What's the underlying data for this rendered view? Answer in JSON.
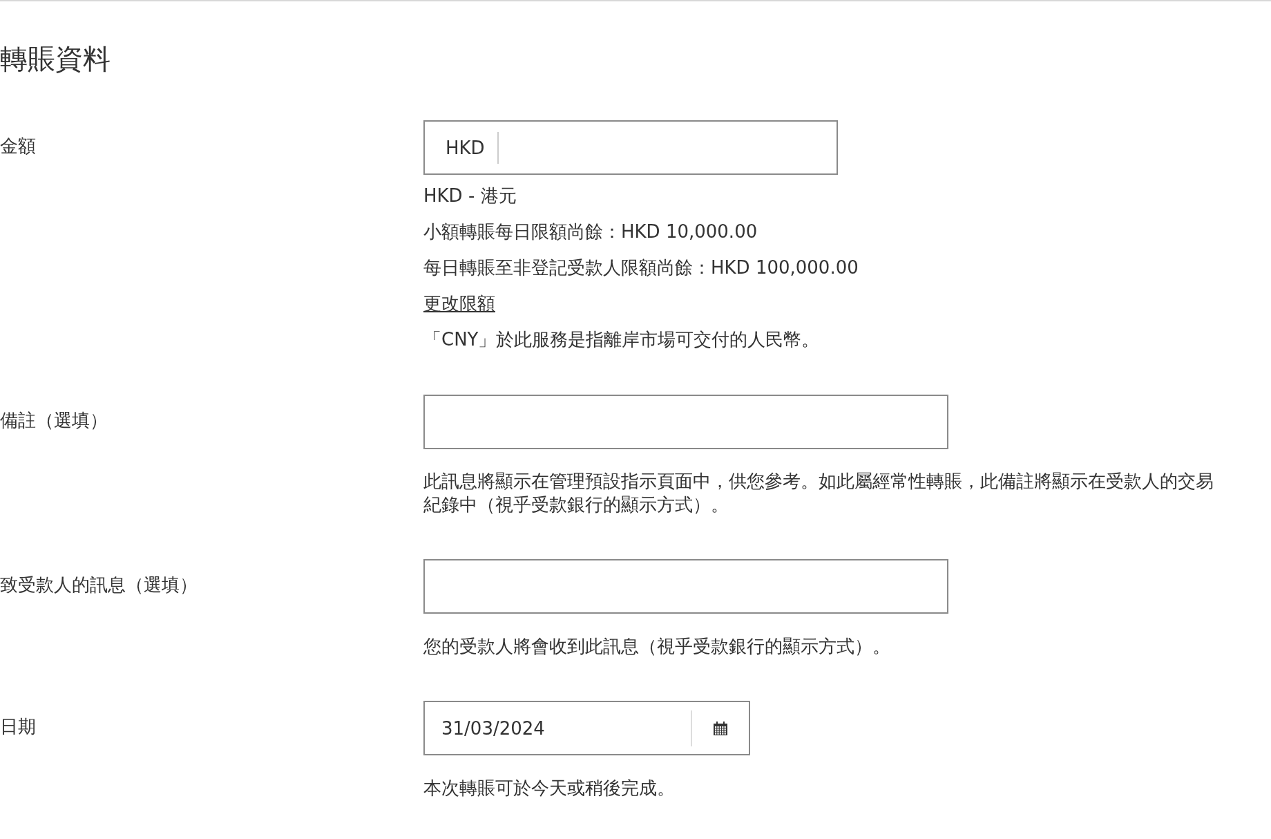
{
  "section_title": "轉賬資料",
  "amount": {
    "label": "金額",
    "currency_prefix": "HKD",
    "notes": [
      {
        "kind": "text",
        "text": "HKD - 港元"
      },
      {
        "kind": "text",
        "text": "小額轉賬每日限額尚餘：HKD 10,000.00"
      },
      {
        "kind": "text",
        "text": "每日轉賬至非登記受款人限額尚餘：HKD 100,000.00"
      },
      {
        "kind": "link",
        "text": "更改限額"
      },
      {
        "kind": "text",
        "text": "「CNY」於此服務是指離岸市場可交付的人民幣。"
      }
    ]
  },
  "memo": {
    "label": "備註（選填）",
    "help": "此訊息將顯示在管理預設指示頁面中，供您參考。如此屬經常性轉賬，此備註將顯示在受款人的交易紀錄中（視乎受款銀行的顯示方式）。"
  },
  "message": {
    "label": "致受款人的訊息（選填）",
    "help": "您的受款人將會收到此訊息（視乎受款銀行的顯示方式）。"
  },
  "date": {
    "label": "日期",
    "value": "31/03/2024",
    "help": "本次轉賬可於今天或稍後完成。"
  }
}
